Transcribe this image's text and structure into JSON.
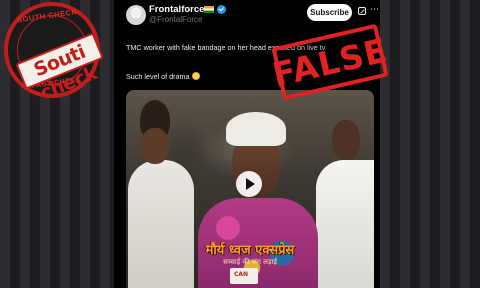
{
  "post": {
    "user_name": "Frontalforce",
    "handle": "@FrontalForce",
    "subscribe_label": "Subscribe",
    "text_line1": "TMC worker with fake bandage on her head exposed on live tv",
    "text_line2": "Such level of drama",
    "emoji": "face-with-rolling-eyes-icon"
  },
  "video": {
    "overlay_text": "मौर्य ध्वज एक्सप्रेस",
    "overlay_subtext": "सच्चाई की जंग लड़ाई",
    "mic_label": "CAN"
  },
  "badge": {
    "top_text": "SOUTH CHECK",
    "bottom_text": "FACT-CHECK",
    "label": "Souti check"
  },
  "verdict": {
    "label": "FALSE"
  },
  "colors": {
    "stamp_red": "#e02222",
    "verified_blue": "#1d9bf0",
    "hindi_orange": "#ff9b2b"
  }
}
